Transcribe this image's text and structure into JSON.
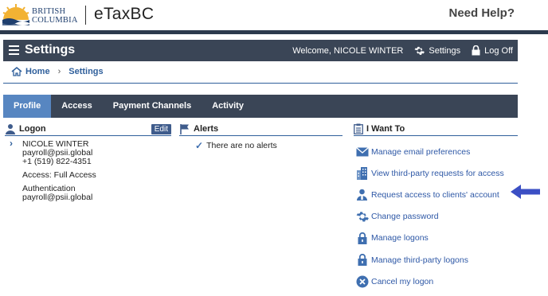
{
  "header": {
    "logo_line1": "BRITISH",
    "logo_line2": "COLUMBIA",
    "brand": "eTaxBC",
    "help": "Need Help?"
  },
  "nav": {
    "title": "Settings",
    "welcome": "Welcome, NICOLE WINTER",
    "settings_label": "Settings",
    "logoff_label": "Log Off"
  },
  "breadcrumb": {
    "home": "Home",
    "current": "Settings"
  },
  "tabs": [
    {
      "label": "Profile",
      "active": true
    },
    {
      "label": "Access",
      "active": false
    },
    {
      "label": "Payment Channels",
      "active": false
    },
    {
      "label": "Activity",
      "active": false
    }
  ],
  "logon": {
    "title": "Logon",
    "edit": "Edit",
    "name": "NICOLE WINTER",
    "email": "payroll@psii.global",
    "phone": "+1 (519) 822-4351",
    "access": "Access: Full Access",
    "auth_label": "Authentication",
    "auth_value": "payroll@psii.global"
  },
  "alerts": {
    "title": "Alerts",
    "message": "There are no alerts"
  },
  "iwant": {
    "title": "I Want To",
    "items": [
      {
        "label": "Manage email preferences",
        "icon": "envelope-icon"
      },
      {
        "label": "View third-party requests for access",
        "icon": "building-icon"
      },
      {
        "label": "Request access to clients' account",
        "icon": "user-request-icon"
      },
      {
        "label": "Change password",
        "icon": "gear-icon"
      },
      {
        "label": "Manage logons",
        "icon": "lock-icon"
      },
      {
        "label": "Manage third-party logons",
        "icon": "lock-icon"
      },
      {
        "label": "Cancel my logon",
        "icon": "cancel-icon"
      }
    ]
  },
  "colors": {
    "navbar": "#3a4556",
    "tab_active": "#5786c1",
    "link": "#2e58a6",
    "arrow": "#3b4fc4"
  }
}
